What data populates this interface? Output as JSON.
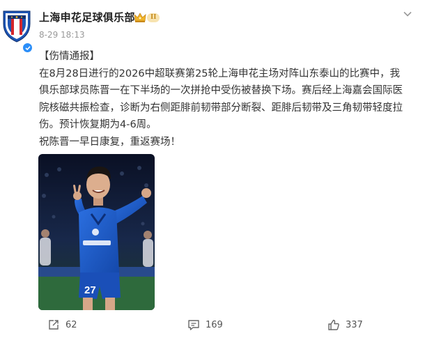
{
  "post": {
    "author": "上海申花足球俱乐部",
    "vip_level": "II",
    "time": "8-29 18:13",
    "content": {
      "tag": "【伤情通报】",
      "lines": [
        "在8月28日进行的2026中超联赛第25轮上海申花主场对阵山东泰山的比赛中，我",
        "俱乐部球员陈晋一在下半场的一次拼抢中受伤被替换下场。赛后经上海嘉会国际医",
        "院核磁共振检查，诊断为右侧距腓前韧带部分断裂、距腓后韧带及三角韧带轻度拉",
        "伤。预计恢复期为4-6周。",
        "祝陈晋一早日康复，重返赛场！"
      ]
    },
    "photo": {
      "jersey_number": "27"
    },
    "actions": {
      "repost_count": "62",
      "comment_count": "169",
      "like_count": "337"
    }
  },
  "icons": [
    "avatar-logo",
    "verified-icon",
    "vip-crown-icon",
    "chevron-down-icon",
    "repost-icon",
    "comment-icon",
    "like-icon"
  ],
  "colors": {
    "verified": "#2b8ef8",
    "club_blue": "#1d55b4",
    "club_red": "#d4262c",
    "text": "#333333",
    "meta": "#999999"
  }
}
